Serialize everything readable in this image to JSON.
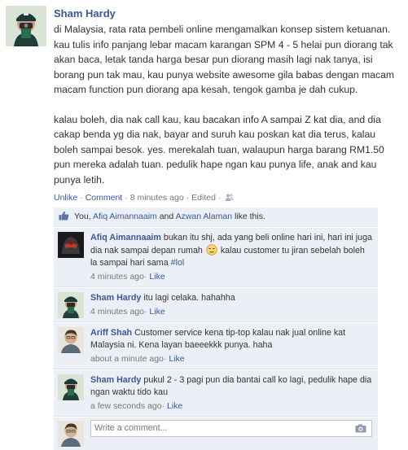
{
  "post": {
    "author": "Sham Hardy",
    "paragraphs": [
      "di Malaysia, rata rata pembeli online mengamalkan konsep sistem ketuanan. kau tulis info panjang lebar macam karangan SPM 4 - 5 helai pun diorang tak akan baca, letak tanda harga besar pun diorang masih lagi nak tanya, isi borang pun tak mau, kau punya website awesome gila babas dengan macam macam function pun diorang apa kesah, tengok gamba je dah cukup.",
      "kalau boleh, dia nak call kau, kau bacakan info A sampai Z kat dia, and dia cakap benda yg dia nak, bayar and suruh kau poskan kat dia terus, kalau boleh sampai besok. yes. merekalah tuan, walaupun harga barang RM1.50 pun mereka adalah tuan. pedulik hape ngan kau punya life, anak and kau punya letih."
    ],
    "actions": {
      "unlike": "Unlike",
      "comment": "Comment",
      "time": "8 minutes ago",
      "edited": "Edited",
      "sep": "·"
    }
  },
  "likes": {
    "you": "You,",
    "person1": "Afiq Aimannaaim",
    "and": "and",
    "person2": "Azwan Alaman",
    "suffix": "like this."
  },
  "comments": [
    {
      "author": "Afiq Aimannaaim",
      "text_before": "bukan itu shj, ada yang beli online hari ini, hari ini juga dia nak sampai depan rumah",
      "text_after": "kalau customer tu jiran sebelah boleh la sampai hari sama",
      "tag": "#lol",
      "time": "4 minutes ago",
      "like": "Like"
    },
    {
      "author": "Sham Hardy",
      "text": "itu lagi celaka. hahahha",
      "time": "4 minutes ago",
      "like": "Like"
    },
    {
      "author": "Ariff Shah",
      "text": "Customer service kena tip-top kalau nak jual online kat Malaysia ni. Kena layan baeeekkk punya. haha",
      "time": "about a minute ago",
      "like": "Like"
    },
    {
      "author": "Sham Hardy",
      "text": "pukul 2 - 3 pagi pun dia bantai call ko lagi, pedulik hape dia ngan waktu tido kau",
      "time": "a few seconds ago",
      "like": "Like"
    }
  ],
  "write_comment": {
    "placeholder": "Write a comment..."
  },
  "icons": {
    "people": "people-icon",
    "thumb": "thumbs-up-icon",
    "emoji": "unamused-face-icon",
    "camera": "camera-icon"
  },
  "colors": {
    "link": "#3b5998",
    "ufi_bg": "#eceff5",
    "meta": "#777777"
  }
}
